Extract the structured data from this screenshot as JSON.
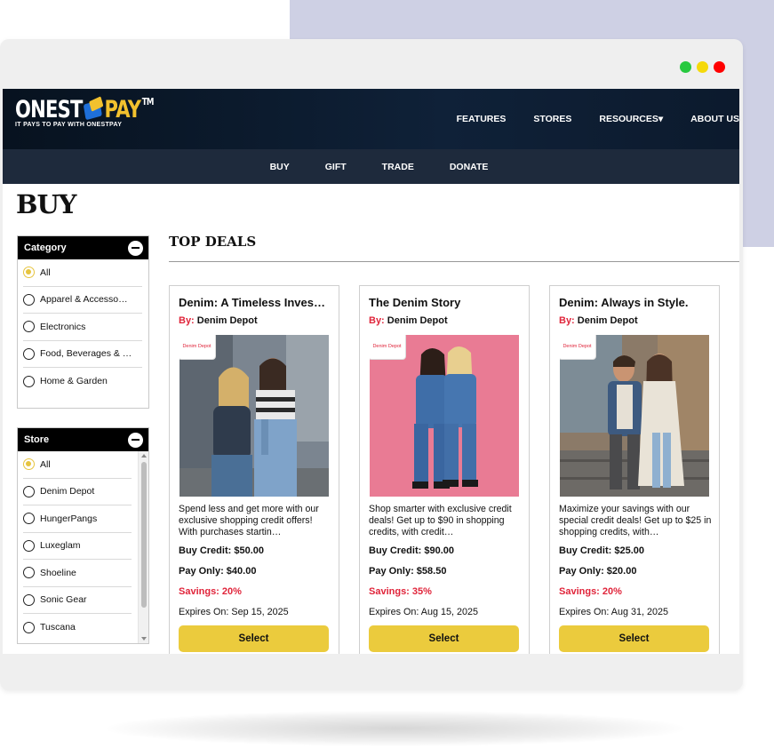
{
  "window": {
    "dot_colors": [
      "#27c93f",
      "#f5d90a",
      "#ff0000"
    ]
  },
  "brand": {
    "logo_part1": "ONEST",
    "logo_part2": "PAY",
    "trademark": "TM",
    "tagline": "IT PAYS TO PAY WITH ONESTPAY"
  },
  "nav": {
    "items": [
      "FEATURES",
      "STORES",
      "RESOURCES",
      "ABOUT US"
    ],
    "resources_caret": "▾"
  },
  "subnav": {
    "items": [
      "BUY",
      "GIFT",
      "TRADE",
      "DONATE"
    ]
  },
  "page": {
    "title": "BUY"
  },
  "category": {
    "header": "Category",
    "options": [
      "All",
      "Apparel & Accesso…",
      "Electronics",
      "Food, Beverages & …",
      "Home & Garden"
    ],
    "selected": "All"
  },
  "store": {
    "header": "Store",
    "options": [
      "All",
      "Denim Depot",
      "HungerPangs",
      "Luxeglam",
      "Shoeline",
      "Sonic Gear",
      "Tuscana"
    ],
    "selected": "All"
  },
  "deals": {
    "title": "TOP DEALS",
    "cards": [
      {
        "title": "Denim: A Timeless Inves…",
        "by_label": "By:",
        "store": "Denim Depot",
        "badge": "Denim Depot",
        "description": "Spend less and get more with our exclusive shopping credit offers! With purchases startin…",
        "buy_credit": "Buy Credit: $50.00",
        "pay_only": "Pay Only: $40.00",
        "savings": "Savings: 20%",
        "expires": "Expires On: Sep 15, 2025",
        "button": "Select"
      },
      {
        "title": "The Denim Story",
        "by_label": "By:",
        "store": "Denim Depot",
        "badge": "Denim Depot",
        "description": "Shop smarter with exclusive credit deals! Get up to $90 in shopping credits, with credit…",
        "buy_credit": "Buy Credit: $90.00",
        "pay_only": "Pay Only: $58.50",
        "savings": "Savings: 35%",
        "expires": "Expires On: Aug 15, 2025",
        "button": "Select"
      },
      {
        "title": "Denim: Always in Style.",
        "by_label": "By:",
        "store": "Denim Depot",
        "badge": "Denim Depot",
        "description": "Maximize your savings with our special credit deals! Get up to $25 in shopping credits, with…",
        "buy_credit": "Buy Credit: $25.00",
        "pay_only": "Pay Only: $20.00",
        "savings": "Savings: 20%",
        "expires": "Expires On: Aug 31, 2025",
        "button": "Select"
      }
    ]
  }
}
